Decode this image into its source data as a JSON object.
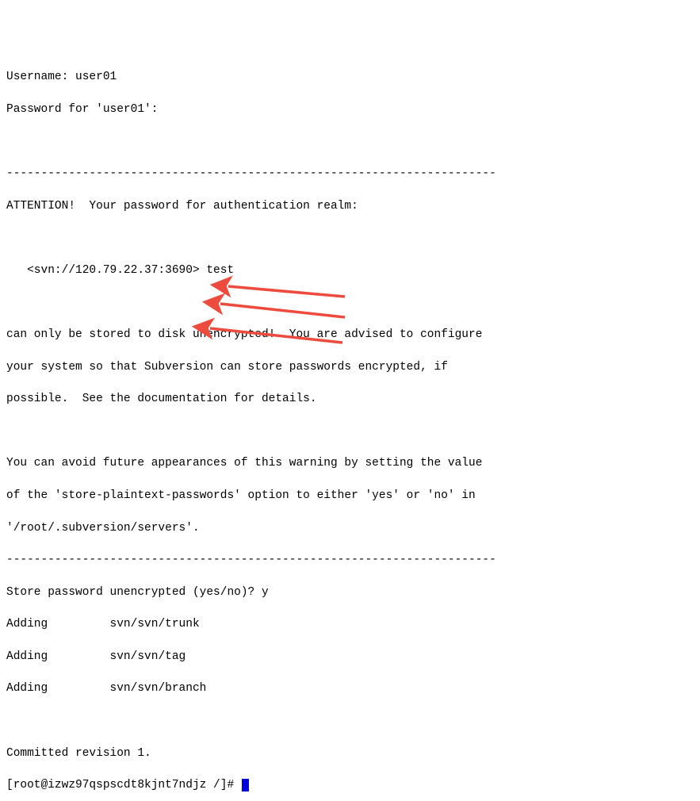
{
  "lines": {
    "username_label": "Username: ",
    "username": "user01",
    "password_prompt": "Password for 'user01':",
    "divider": "-----------------------------------------------------------------------",
    "attention": "ATTENTION!  Your password for authentication realm:",
    "realm_indent": "   ",
    "realm": "<svn://120.79.22.37:3690> test",
    "warn1": "can only be stored to disk unencrypted!  You are advised to configure",
    "warn2": "your system so that Subversion can store passwords encrypted, if",
    "warn3": "possible.  See the documentation for details.",
    "warn4": "You can avoid future appearances of this warning by setting the value",
    "warn5": "of the 'store-plaintext-passwords' option to either 'yes' or 'no' in",
    "warn6": "'/root/.subversion/servers'.",
    "store_prompt": "Store password unencrypted (yes/no)? ",
    "store_answer": "y",
    "adding_label": "Adding         ",
    "path1": "svn/svn/trunk",
    "path2": "svn/svn/tag",
    "path3": "svn/svn/branch",
    "committed": "Committed revision 1.",
    "shell_prompt": "[root@izwz97qspscdt8kjnt7ndjz /]# "
  },
  "annotations": {
    "arrow_color": "#ed4b3d"
  }
}
